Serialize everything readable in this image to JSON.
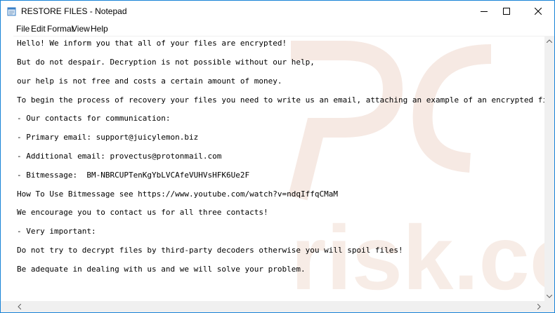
{
  "window": {
    "title": "RESTORE FILES - Notepad",
    "icon": "notepad-icon",
    "controls": [
      "minimize-icon",
      "maximize-icon",
      "close-icon"
    ]
  },
  "menu": {
    "items": [
      "File",
      "Edit",
      "Format",
      "View",
      "Help"
    ]
  },
  "document": {
    "lines": [
      "Hello! We inform you that all of your files are encrypted!",
      "But do not despair. Decryption is not possible without our help,",
      "our help is not free and costs a certain amount of money.",
      "To begin the process of recovery your files you need to write us an email, attaching an example of an encrypted file.",
      "- Our contacts for communication:",
      "- Primary email: support@juicylemon.biz",
      "- Additional email: provectus@protonmail.com",
      "- Bitmessage:  BM-NBRCUPTenKgYbLVCAfeVUHVsHFK6Ue2F",
      "How To Use Bitmessage see https://www.youtube.com/watch?v=ndqIffqCMaM",
      "We encourage you to contact us for all three contacts!",
      "- Very important:",
      "Do not try to decrypt files by third-party decoders otherwise you will spoil files!",
      "Be adequate in dealing with us and we will solve your problem."
    ]
  },
  "colors": {
    "border": "#1883d7",
    "scrollbar": "#f0f0f0",
    "watermark": "#f6e9e3"
  }
}
